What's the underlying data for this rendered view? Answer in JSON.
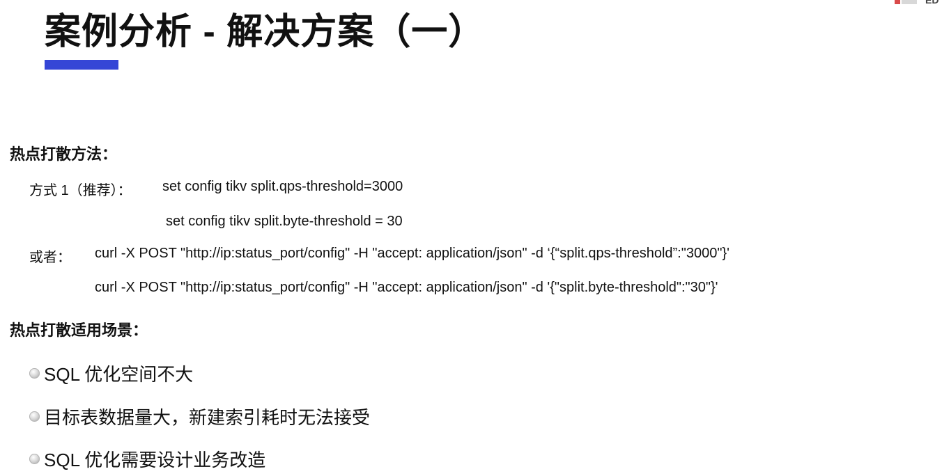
{
  "title": "案例分析 - 解决方案（一）",
  "colors": {
    "accent_bar": "#3546d6",
    "text": "#111111"
  },
  "corner_logo": {
    "text": "ED"
  },
  "section_method": {
    "heading": "热点打散方法：",
    "option1_label": "方式 1（推荐）：",
    "option1_lines": [
      "set config tikv split.qps-threshold=3000",
      "set config tikv split.byte-threshold = 30"
    ],
    "option2_label": "或者：",
    "option2_lines": [
      "curl -X POST \"http://ip:status_port/config\" -H \"accept: application/json\" -d ‘{“split.qps-threshold”:\"3000\"}'",
      "curl -X POST \"http://ip:status_port/config\" -H \"accept: application/json\" -d '{\"split.byte-threshold\":\"30\"}'"
    ]
  },
  "section_scenarios": {
    "heading": "热点打散适用场景：",
    "bullet_icon": "bullet-dot-icon",
    "items": [
      "SQL 优化空间不大",
      "目标表数据量大，新建索引耗时无法接受",
      "SQL 优化需要设计业务改造"
    ]
  }
}
